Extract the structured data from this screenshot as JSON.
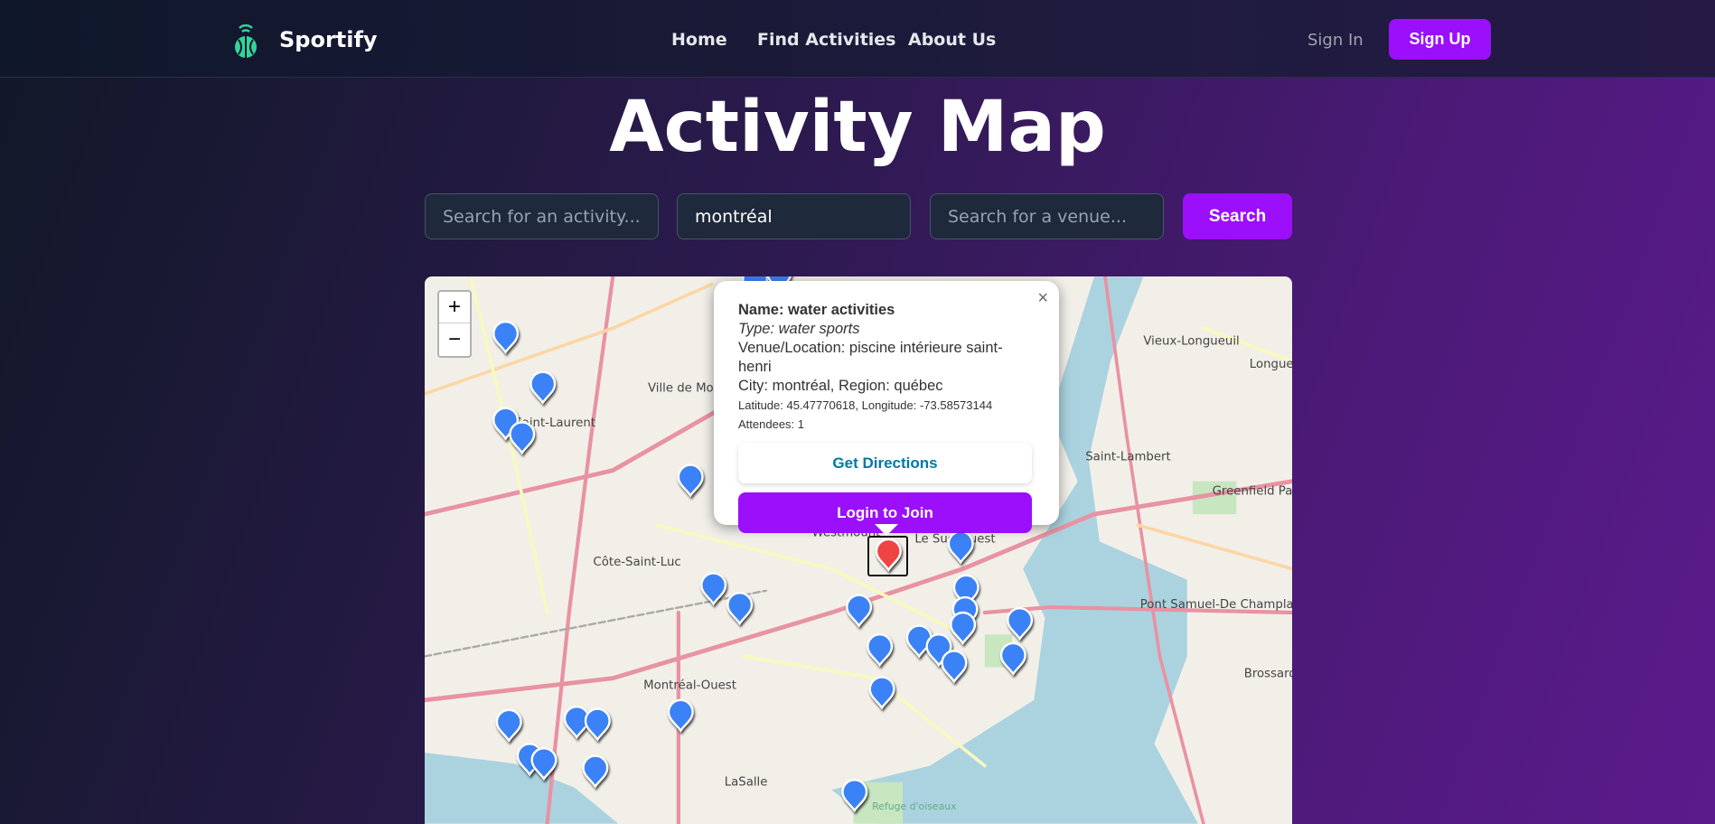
{
  "nav": {
    "brand": "Sportify",
    "links": [
      "Home",
      "Find Activities",
      "About Us"
    ],
    "sign_in": "Sign In",
    "sign_up": "Sign Up"
  },
  "page": {
    "title": "Activity Map"
  },
  "search": {
    "activity_placeholder": "Search for an activity...",
    "city_value": "montréal",
    "venue_placeholder": "Search for a venue...",
    "button": "Search"
  },
  "map": {
    "zoom_in": "+",
    "zoom_out": "−",
    "labels": [
      "Ville de Mont-Royal",
      "Saint-Laurent",
      "Côte-Saint-Luc",
      "Westmount",
      "Le Sud-Ouest",
      "Montréal-Ouest",
      "LaSalle",
      "Saint-Lambert",
      "Greenfield Park",
      "Vieux-Longueuil",
      "Longueuil",
      "Pont Samuel-De Champlain",
      "Brossard",
      "Refuge d'oiseaux"
    ],
    "marker_color": "#3b82f6",
    "selected_marker_color": "#ef4444",
    "popup": {
      "name": "Name: water activities",
      "type": "Type: water sports",
      "venue": "Venue/Location: piscine intérieure saint-henri",
      "city": "City: montréal, Region: québec",
      "coords": "Latitude: 45.47770618, Longitude: -73.58573144",
      "attendees": "Attendees: 1",
      "directions": "Get Directions",
      "join": "Login to Join",
      "close": "×"
    }
  },
  "colors": {
    "accent": "#9b0ffb",
    "link": "#0078a8"
  }
}
